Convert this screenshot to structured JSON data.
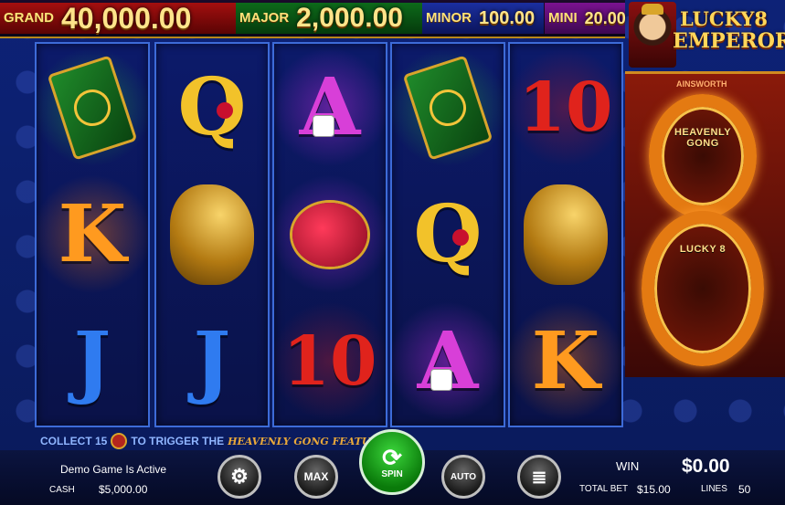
{
  "jackpots": {
    "grand": {
      "label": "GRAND",
      "value": "40,000.00"
    },
    "major": {
      "label": "MAJOR",
      "value": "2,000.00"
    },
    "minor": {
      "label": "MINOR",
      "value": "100.00"
    },
    "mini": {
      "label": "MINI",
      "value": "20.00"
    }
  },
  "logo": {
    "line1": "LUCKY8",
    "line2": "EMPEROR"
  },
  "side_panel": {
    "brand": "AINSWORTH",
    "top_label": "HEAVENLY GONG",
    "bottom_label": "LUCKY 8"
  },
  "reels": [
    {
      "symbols": [
        {
          "type": "book",
          "icon": "jade-book-icon"
        },
        {
          "type": "letter",
          "text": "K",
          "icon": "king-crown-icon"
        },
        {
          "type": "letter",
          "text": "J",
          "icon": "fleur-de-lis-icon"
        }
      ]
    },
    {
      "symbols": [
        {
          "type": "letter",
          "text": "Q",
          "icon": "rose-icon"
        },
        {
          "type": "dragon",
          "icon": "golden-dragon-icon"
        },
        {
          "type": "letter",
          "text": "J",
          "icon": "fleur-de-lis-icon"
        }
      ]
    },
    {
      "symbols": [
        {
          "type": "letter",
          "text": "A",
          "icon": "dice-icon"
        },
        {
          "type": "lantern",
          "icon": "lantern-icon"
        },
        {
          "type": "letter",
          "text": "10"
        }
      ]
    },
    {
      "symbols": [
        {
          "type": "book",
          "icon": "jade-book-icon"
        },
        {
          "type": "letter",
          "text": "Q",
          "icon": "rose-icon"
        },
        {
          "type": "letter",
          "text": "A",
          "icon": "dice-icon"
        }
      ]
    },
    {
      "symbols": [
        {
          "type": "letter",
          "text": "10"
        },
        {
          "type": "dragon",
          "icon": "golden-dragon-icon"
        },
        {
          "type": "letter",
          "text": "K",
          "icon": "king-crown-icon"
        }
      ]
    }
  ],
  "feature_message": {
    "prefix": "COLLECT 15",
    "middle": "TO TRIGGER THE",
    "feature_name": "HEAVENLY GONG FEATURE"
  },
  "status": {
    "demo_text": "Demo Game Is Active",
    "cash_label": "CASH",
    "cash_value": "$5,000.00"
  },
  "controls": {
    "settings_icon": "gear-icon",
    "max_label": "MAX",
    "spin_label": "SPIN",
    "auto_label": "AUTO",
    "coins_icon": "coin-stack-icon"
  },
  "win": {
    "label": "WIN",
    "value": "$0.00"
  },
  "bet": {
    "total_label": "TOTAL BET",
    "total_value": "$15.00",
    "lines_label": "LINES",
    "lines_value": "50"
  },
  "colors": {
    "reel_border": "#3d6bd8",
    "spin_green": "#0a7a0a",
    "grand_red": "#a30f0f",
    "major_green": "#0d6a1a",
    "minor_blue": "#1b2fa0",
    "mini_purple": "#7a1290"
  }
}
